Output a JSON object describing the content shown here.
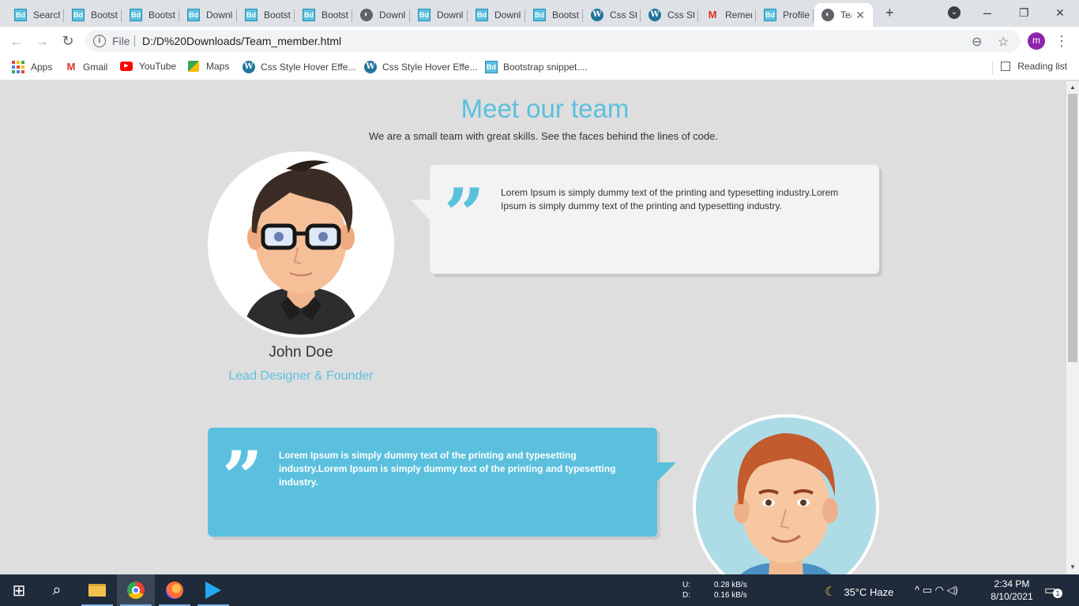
{
  "tabs": [
    {
      "icon": "bd",
      "label": "Search"
    },
    {
      "icon": "bd",
      "label": "Bootstrap"
    },
    {
      "icon": "bd",
      "label": "Bootstrap"
    },
    {
      "icon": "bd",
      "label": "Download"
    },
    {
      "icon": "bd",
      "label": "Bootstrap"
    },
    {
      "icon": "bd",
      "label": "Bootstrap"
    },
    {
      "icon": "globe",
      "label": "Download"
    },
    {
      "icon": "bd",
      "label": "Download"
    },
    {
      "icon": "bd",
      "label": "Download"
    },
    {
      "icon": "bd",
      "label": "Bootstrap"
    },
    {
      "icon": "wp",
      "label": "Css Style"
    },
    {
      "icon": "wp",
      "label": "Css Style"
    },
    {
      "icon": "gmail",
      "label": "Remember"
    },
    {
      "icon": "bd",
      "label": "Profile"
    },
    {
      "icon": "globe",
      "label": "Team"
    }
  ],
  "favicon_text": {
    "bd": "Bd",
    "wp": "W",
    "gmail": "M",
    "globe": "◐"
  },
  "browser": {
    "new_tab": "+",
    "tab_close": "✕",
    "scheme": "File",
    "url": "D:/D%20Downloads/Team_member.html",
    "profile_initial": "m",
    "window_min": "–",
    "window_restore": "❐",
    "window_close": "✕",
    "menu": "⋮",
    "back": "←",
    "forward": "→",
    "reload": "↻",
    "info": "i",
    "zoom": "⊖",
    "star": "☆",
    "tab_search": "⌄"
  },
  "bookmarks": [
    {
      "icon": "apps",
      "label": "Apps"
    },
    {
      "icon": "gmail",
      "label": "Gmail"
    },
    {
      "icon": "youtube",
      "label": "YouTube"
    },
    {
      "icon": "maps",
      "label": "Maps"
    },
    {
      "icon": "wp",
      "label": "Css Style Hover Effe..."
    },
    {
      "icon": "wp",
      "label": "Css Style Hover Effe..."
    },
    {
      "icon": "bd",
      "label": "Bootstrap snippet...."
    }
  ],
  "reading_list": "Reading list",
  "page": {
    "title": "Meet our team",
    "subtitle": "We are a small team with great skills. See the faces behind the lines of code.",
    "quote_mark": "”",
    "members": [
      {
        "name": "John Doe",
        "role": "Lead Designer & Founder",
        "quote": "Lorem Ipsum is simply dummy text of the printing and typesetting industry.Lorem Ipsum is simply dummy text of the printing and typesetting industry."
      },
      {
        "name": "",
        "role": "",
        "quote": "Lorem Ipsum is simply dummy text of the printing and typesetting industry.Lorem Ipsum is simply dummy text of the printing and typesetting industry."
      }
    ]
  },
  "colors": {
    "accent": "#5bc0de",
    "card_light": "#f3f3f3",
    "page_bg": "#dedede",
    "taskbar": "#1f2a3a"
  },
  "taskbar": {
    "start": "⊞",
    "search": "⌕",
    "net_up_label": "U:",
    "net_down_label": "D:",
    "net_up": "0.28 kB/s",
    "net_down": "0.16 kB/s",
    "weather": "35°C  Haze",
    "weather_icon": "☾",
    "tray": "^  ▭  ◠  ◁)",
    "time": "2:34 PM",
    "date": "8/10/2021",
    "notifications": "1"
  }
}
